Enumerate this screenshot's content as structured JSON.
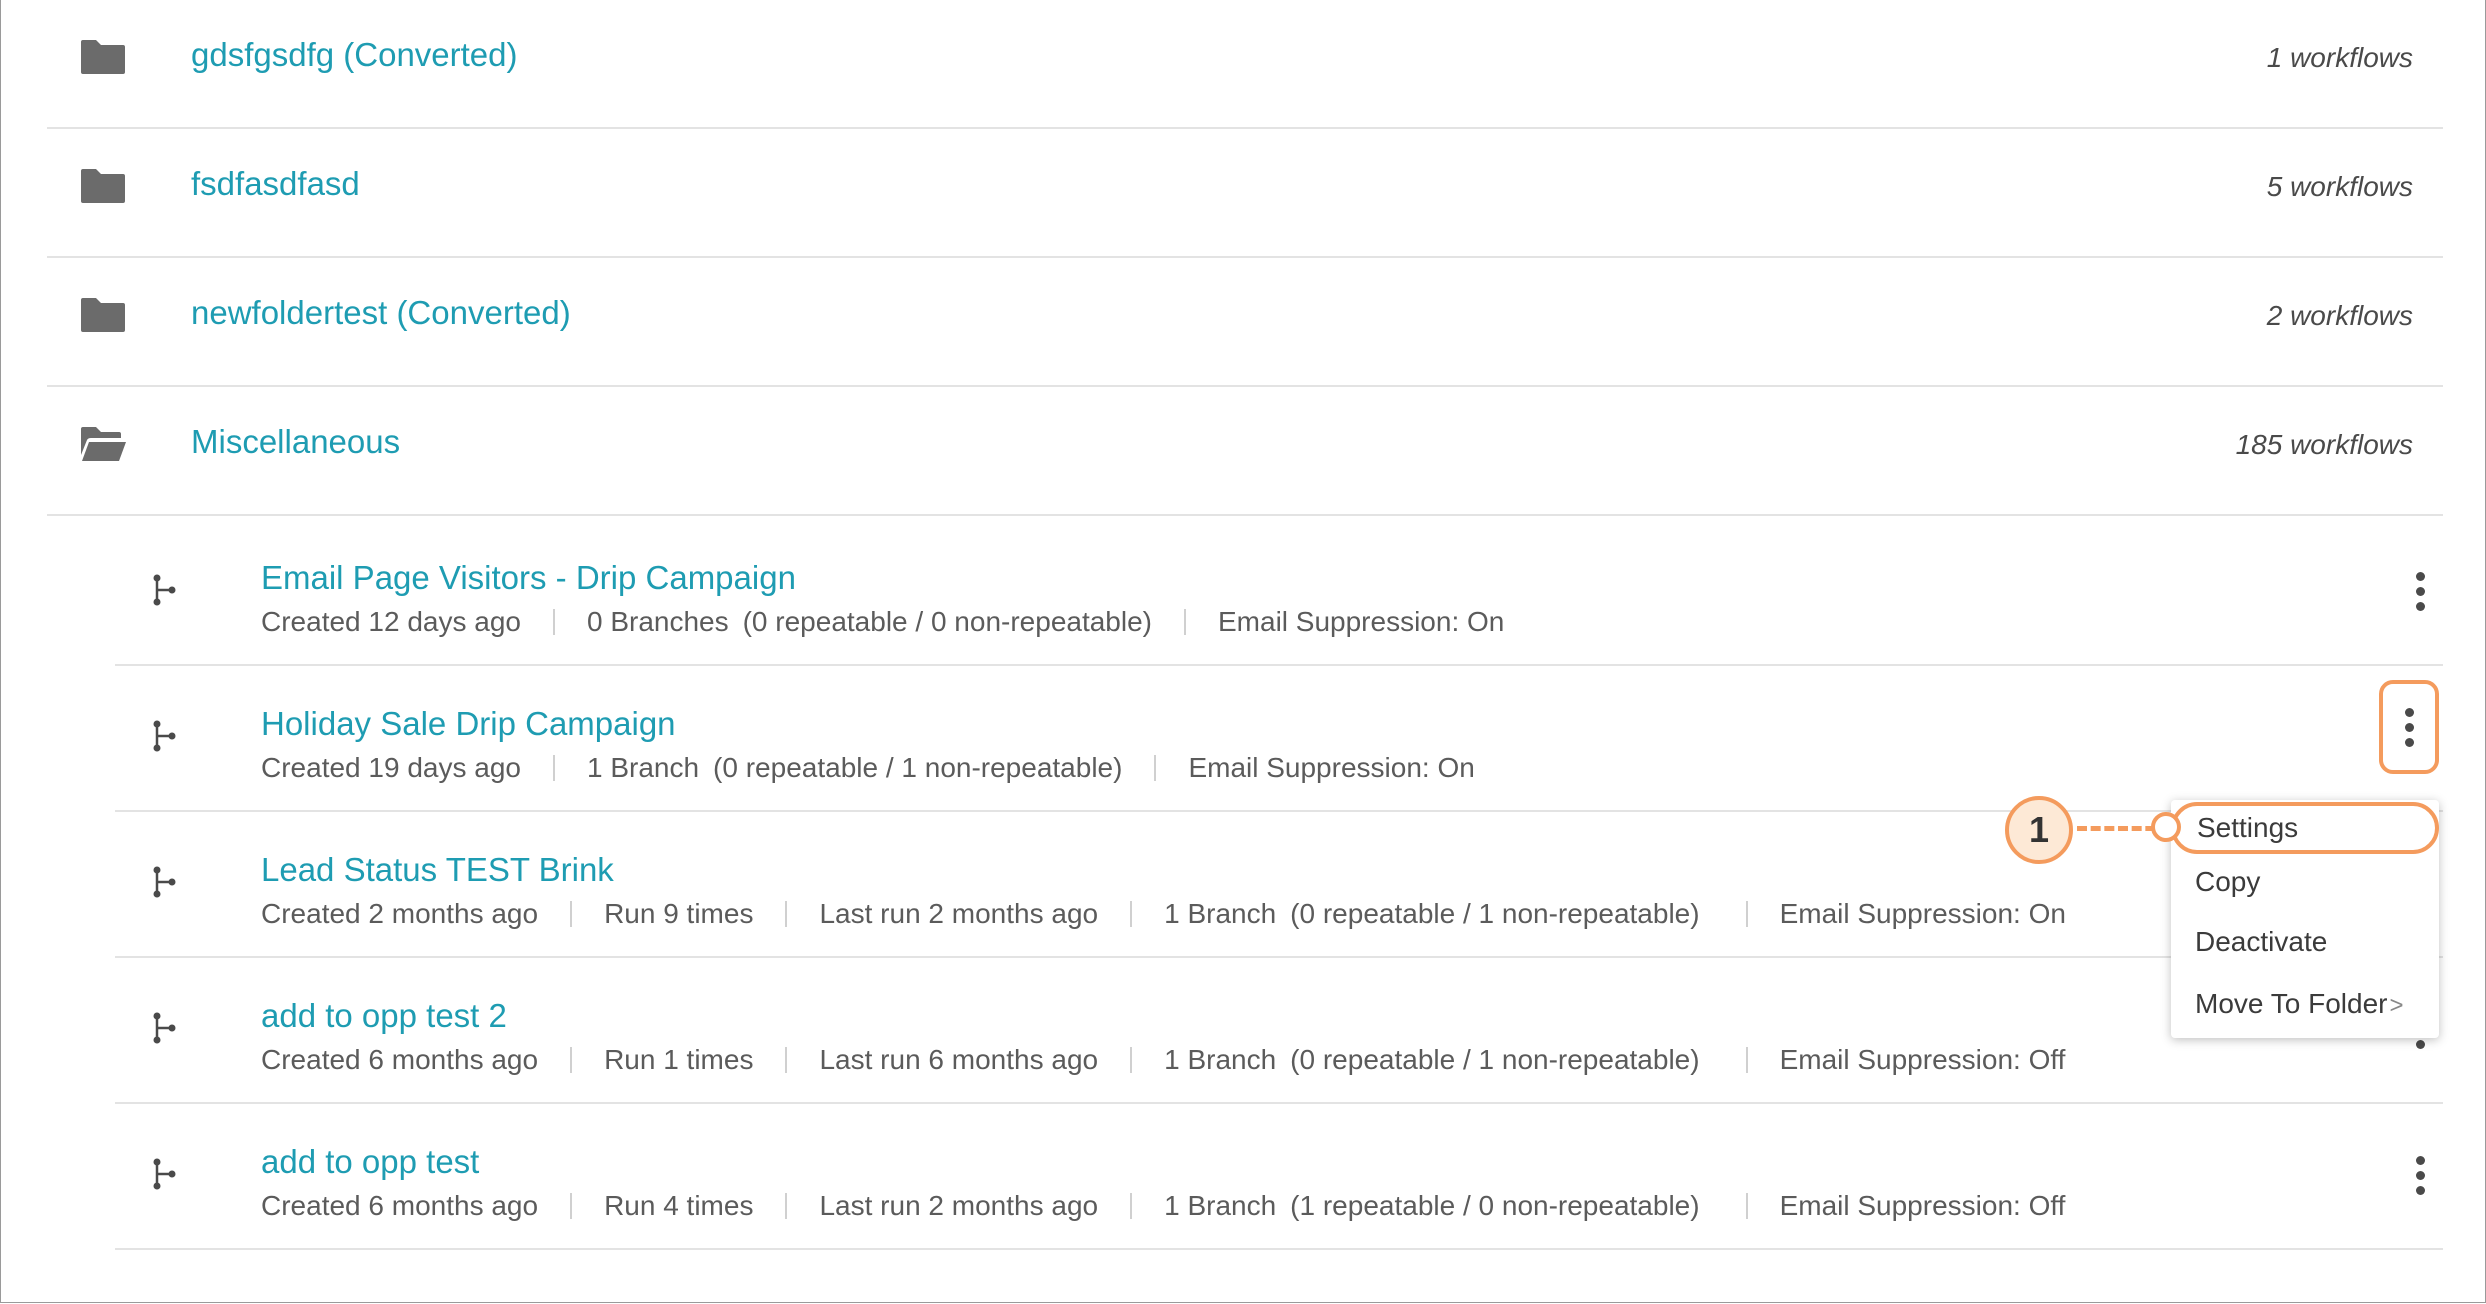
{
  "folders": [
    {
      "name": "gdsfgsdfg (Converted)",
      "count": "1 workflows",
      "icon": "folder-icon"
    },
    {
      "name": "fsdfasdfasd",
      "count": "5 workflows",
      "icon": "folder-icon"
    },
    {
      "name": "newfoldertest (Converted)",
      "count": "2 workflows",
      "icon": "folder-icon"
    },
    {
      "name": "Miscellaneous",
      "count": "185 workflows",
      "icon": "folder-open-icon"
    }
  ],
  "workflows": [
    {
      "title": "Email Page Visitors - Drip Campaign",
      "created": "Created 12 days ago",
      "runs": "",
      "last_run": "",
      "branches": "0 Branches",
      "repeat": "(0 repeatable / 0 non-repeatable)",
      "suppression": "Email Suppression: On"
    },
    {
      "title": "Holiday Sale Drip Campaign",
      "created": "Created 19 days ago",
      "runs": "",
      "last_run": "",
      "branches": "1 Branch",
      "repeat": "(0 repeatable / 1 non-repeatable)",
      "suppression": "Email Suppression: On"
    },
    {
      "title": "Lead Status TEST Brink",
      "created": "Created 2 months ago",
      "runs": "Run 9 times",
      "last_run": "Last run 2 months ago",
      "branches": "1 Branch",
      "repeat": "(0 repeatable / 1 non-repeatable)",
      "suppression": "Email Suppression: On"
    },
    {
      "title": "add to opp test 2",
      "created": "Created 6 months ago",
      "runs": "Run 1 times",
      "last_run": "Last run 6 months ago",
      "branches": "1 Branch",
      "repeat": "(0 repeatable / 1 non-repeatable)",
      "suppression": "Email Suppression: Off"
    },
    {
      "title": "add to opp test",
      "created": "Created 6 months ago",
      "runs": "Run 4 times",
      "last_run": "Last run 2 months ago",
      "branches": "1 Branch",
      "repeat": "(1 repeatable / 0 non-repeatable)",
      "suppression": "Email Suppression: Off"
    }
  ],
  "context_menu": {
    "items": [
      "Settings",
      "Copy",
      "Deactivate",
      "Move To Folder"
    ],
    "submenu_indicator": ">"
  },
  "callout": {
    "number": "1"
  },
  "colors": {
    "link": "#1e9cb2",
    "highlight": "#f49b5d",
    "callout_fill": "#fde9d6",
    "icon": "#6b6b6b"
  }
}
